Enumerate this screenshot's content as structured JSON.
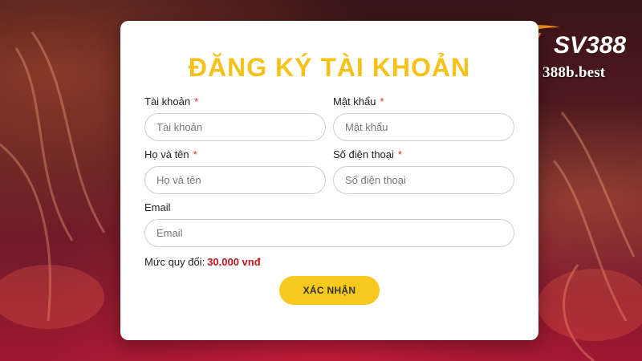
{
  "brand": {
    "logo_text": "SV388",
    "site_url": "388b.best"
  },
  "form": {
    "title": "ĐĂNG KÝ TÀI KHOẢN",
    "required_marker": "*",
    "username": {
      "label": "Tài khoản",
      "placeholder": "Tài khoản",
      "value": ""
    },
    "password": {
      "label": "Mật khẩu",
      "placeholder": "Mật khẩu",
      "value": ""
    },
    "fullname": {
      "label": "Họ và tên",
      "placeholder": "Họ và tên",
      "value": ""
    },
    "phone": {
      "label": "Số điện thoại",
      "placeholder": "Số điện thoại",
      "value": ""
    },
    "email": {
      "label": "Email",
      "placeholder": "Email",
      "value": ""
    },
    "rate_label": "Mức quy đổi:",
    "rate_value": "30.000 vnđ",
    "submit_label": "XÁC NHẬN"
  },
  "colors": {
    "accent": "#f6c21a",
    "required": "#e0262b",
    "rate_value": "#c0161d",
    "button": "#f7c81e"
  }
}
